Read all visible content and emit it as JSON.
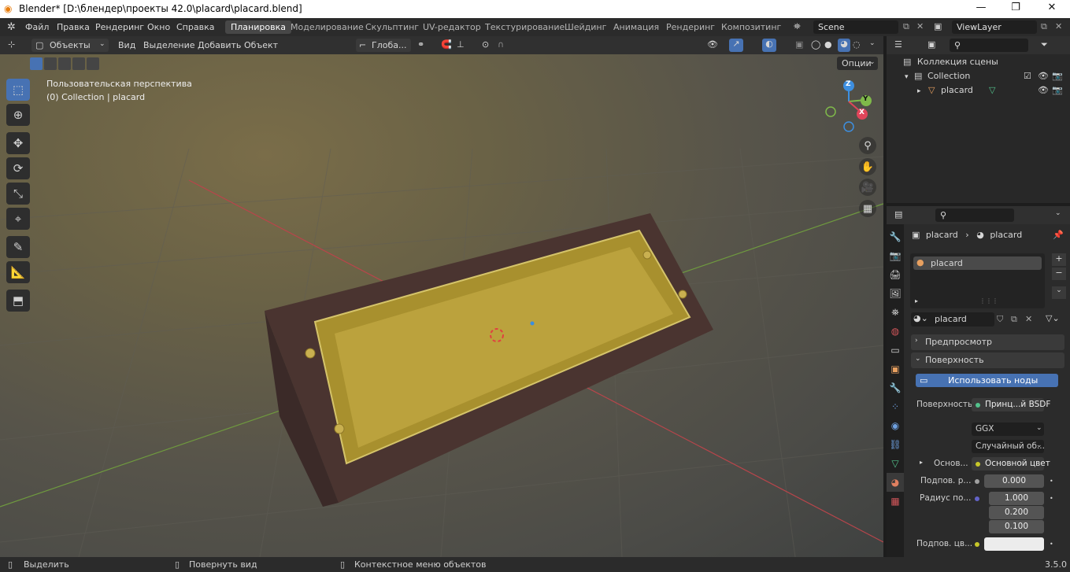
{
  "window": {
    "title": "Blender* [D:\\блендер\\проекты 42.0\\placard\\placard.blend]",
    "minimize": "—",
    "maximize": "❐",
    "close": "✕"
  },
  "menu": {
    "items": [
      "Файл",
      "Правка",
      "Рендеринг",
      "Окно",
      "Справка"
    ],
    "workspaces": [
      "Планировка",
      "Моделирование",
      "Скульптинг",
      "UV-редактор",
      "Текстурирование",
      "Шейдинг",
      "Анимация",
      "Рендеринг",
      "Композитинг"
    ],
    "active_workspace": "Планировка",
    "scene": "Scene",
    "view_layer": "ViewLayer"
  },
  "viewport_header": {
    "mode": "Объекты",
    "menus": [
      "Вид",
      "Выделение",
      "Добавить",
      "Объект"
    ],
    "transform": "Глоба...",
    "options": "Опции"
  },
  "viewport": {
    "perspective": "Пользовательская перспектива",
    "collection_info": "(0) Collection | placard",
    "gizmo_axes": {
      "z": "Z",
      "y": "Y",
      "x": "X"
    }
  },
  "outliner": {
    "scene_collection": "Коллекция сцены",
    "collection": "Collection",
    "object": "placard"
  },
  "properties": {
    "breadcrumb_object": "placard",
    "breadcrumb_material": "placard",
    "slot": "placard",
    "material_name": "placard",
    "preview_section": "Предпросмотр",
    "surface_section": "Поверхность",
    "use_nodes": "Использовать ноды",
    "surface_label": "Поверхность",
    "surface_value": "Принц...й BSDF",
    "distribution": "GGX",
    "subsurface_method": "Случайный об...",
    "base_color_label": "Основ...",
    "base_color_value": "Основной цвет",
    "subsurface_label": "Подпов. р...",
    "subsurface_value": "0.000",
    "radius_label": "Радиус по...",
    "radius_values": [
      "1.000",
      "0.200",
      "0.100"
    ],
    "subsurface_color_label": "Подпов. цв..."
  },
  "status": {
    "select": "Выделить",
    "rotate": "Повернуть вид",
    "context": "Контекстное меню объектов",
    "version": "3.5.0"
  }
}
